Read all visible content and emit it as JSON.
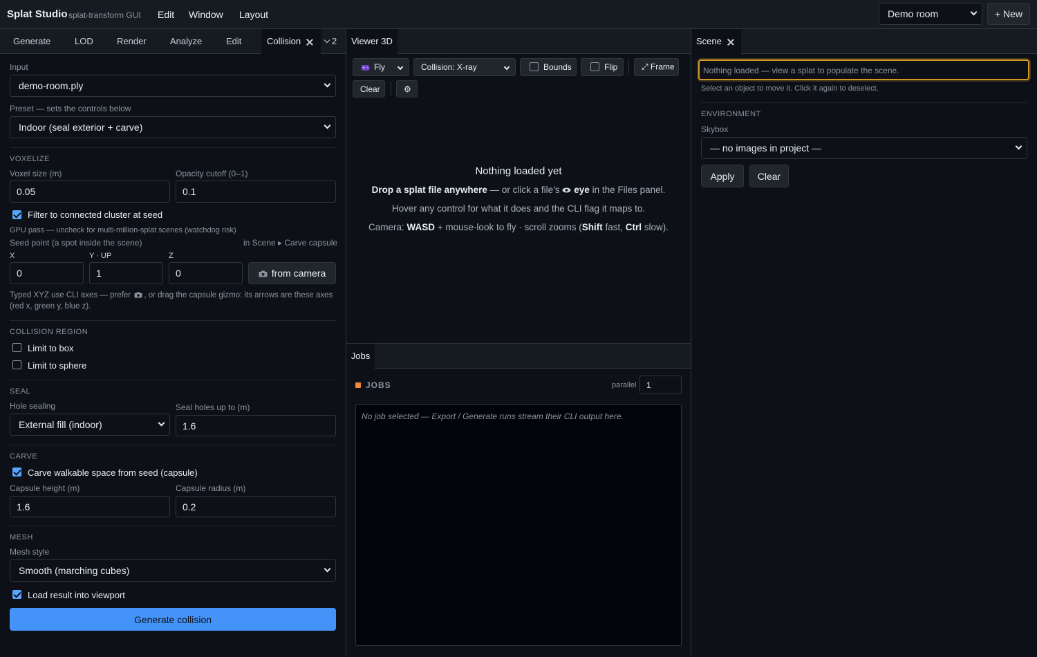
{
  "header": {
    "title": "Splat Studio",
    "subtitle": "splat-transform GUI",
    "menu": [
      "Edit",
      "Window",
      "Layout"
    ],
    "project_select": "Demo room",
    "new_button": "+ New"
  },
  "left_panel": {
    "tabs": [
      "Generate",
      "LOD",
      "Render",
      "Analyze",
      "Edit",
      "Collision"
    ],
    "overflow_count": "2",
    "input_label": "Input",
    "input_value": "demo-room.ply",
    "preset_label": "Preset — sets the controls below",
    "preset_value": "Indoor (seal exterior + carve)",
    "voxelize": {
      "section": "VOXELIZE",
      "voxel_size_label": "Voxel size (m)",
      "voxel_size": "0.05",
      "opacity_label": "Opacity cutoff (0–1)",
      "opacity": "0.1",
      "filter_label": "Filter to connected cluster at seed",
      "filter_checked": true,
      "gpu_help": "GPU pass — uncheck for multi-million-splat scenes (watchdog risk)",
      "seed_label": "Seed point (a spot inside the scene)",
      "seed_hint": "in Scene ▸ Carve capsule",
      "x_label": "X",
      "y_label": "Y · UP",
      "z_label": "Z",
      "x": "0",
      "y": "1",
      "z": "0",
      "from_camera": "from camera",
      "help_line1": "Typed XYZ use CLI axes — prefer",
      "help_line1b": ", or drag the capsule gizmo: its arrows are these axes",
      "help_line2": "(red x, green y, blue z)."
    },
    "region": {
      "section": "COLLISION REGION",
      "box": "Limit to box",
      "sphere": "Limit to sphere"
    },
    "seal": {
      "section": "SEAL",
      "hole_label": "Hole sealing",
      "hole_value": "External fill (indoor)",
      "holes_up_label": "Seal holes up to (m)",
      "holes_up": "1.6"
    },
    "carve": {
      "section": "CARVE",
      "carve_label": "Carve walkable space from seed (capsule)",
      "height_label": "Capsule height (m)",
      "height": "1.6",
      "radius_label": "Capsule radius (m)",
      "radius": "0.2"
    },
    "mesh": {
      "section": "MESH",
      "style_label": "Mesh style",
      "style_value": "Smooth (marching cubes)",
      "load_label": "Load result into viewport"
    },
    "generate_button": "Generate collision"
  },
  "viewer": {
    "tab": "Viewer 3D",
    "mode": "Fly",
    "collision": "Collision: X-ray",
    "bounds": "Bounds",
    "flip": "Flip",
    "frame": "⤢ Frame",
    "clear": "Clear",
    "settings": "⚙",
    "empty_title": "Nothing loaded yet",
    "line1_bold": "Drop a splat file anywhere",
    "line1_rest": " — or click a file's ",
    "line1_eye": "eye",
    "line1_end": " in the Files panel.",
    "line2": "Hover any control for what it does and the CLI flag it maps to.",
    "line3_a": "Camera: ",
    "line3_wasd": "WASD",
    "line3_b": " + mouse-look to fly · scroll zooms (",
    "line3_shift": "Shift",
    "line3_c": " fast, ",
    "line3_ctrl": "Ctrl",
    "line3_d": " slow)."
  },
  "jobs": {
    "tab": "Jobs",
    "title": "JOBS",
    "parallel_label": "parallel",
    "parallel_value": "1",
    "empty": "No job selected — Export / Generate runs stream their CLI output here.",
    "status_color": "#f0883e"
  },
  "scene": {
    "tab": "Scene",
    "search_placeholder": "Nothing loaded — view a splat to populate the scene.",
    "help": "Select an object to move it. Click it again to deselect.",
    "env_section": "ENVIRONMENT",
    "skybox_label": "Skybox",
    "skybox_value": "— no images in project —",
    "apply": "Apply",
    "clear": "Clear"
  }
}
